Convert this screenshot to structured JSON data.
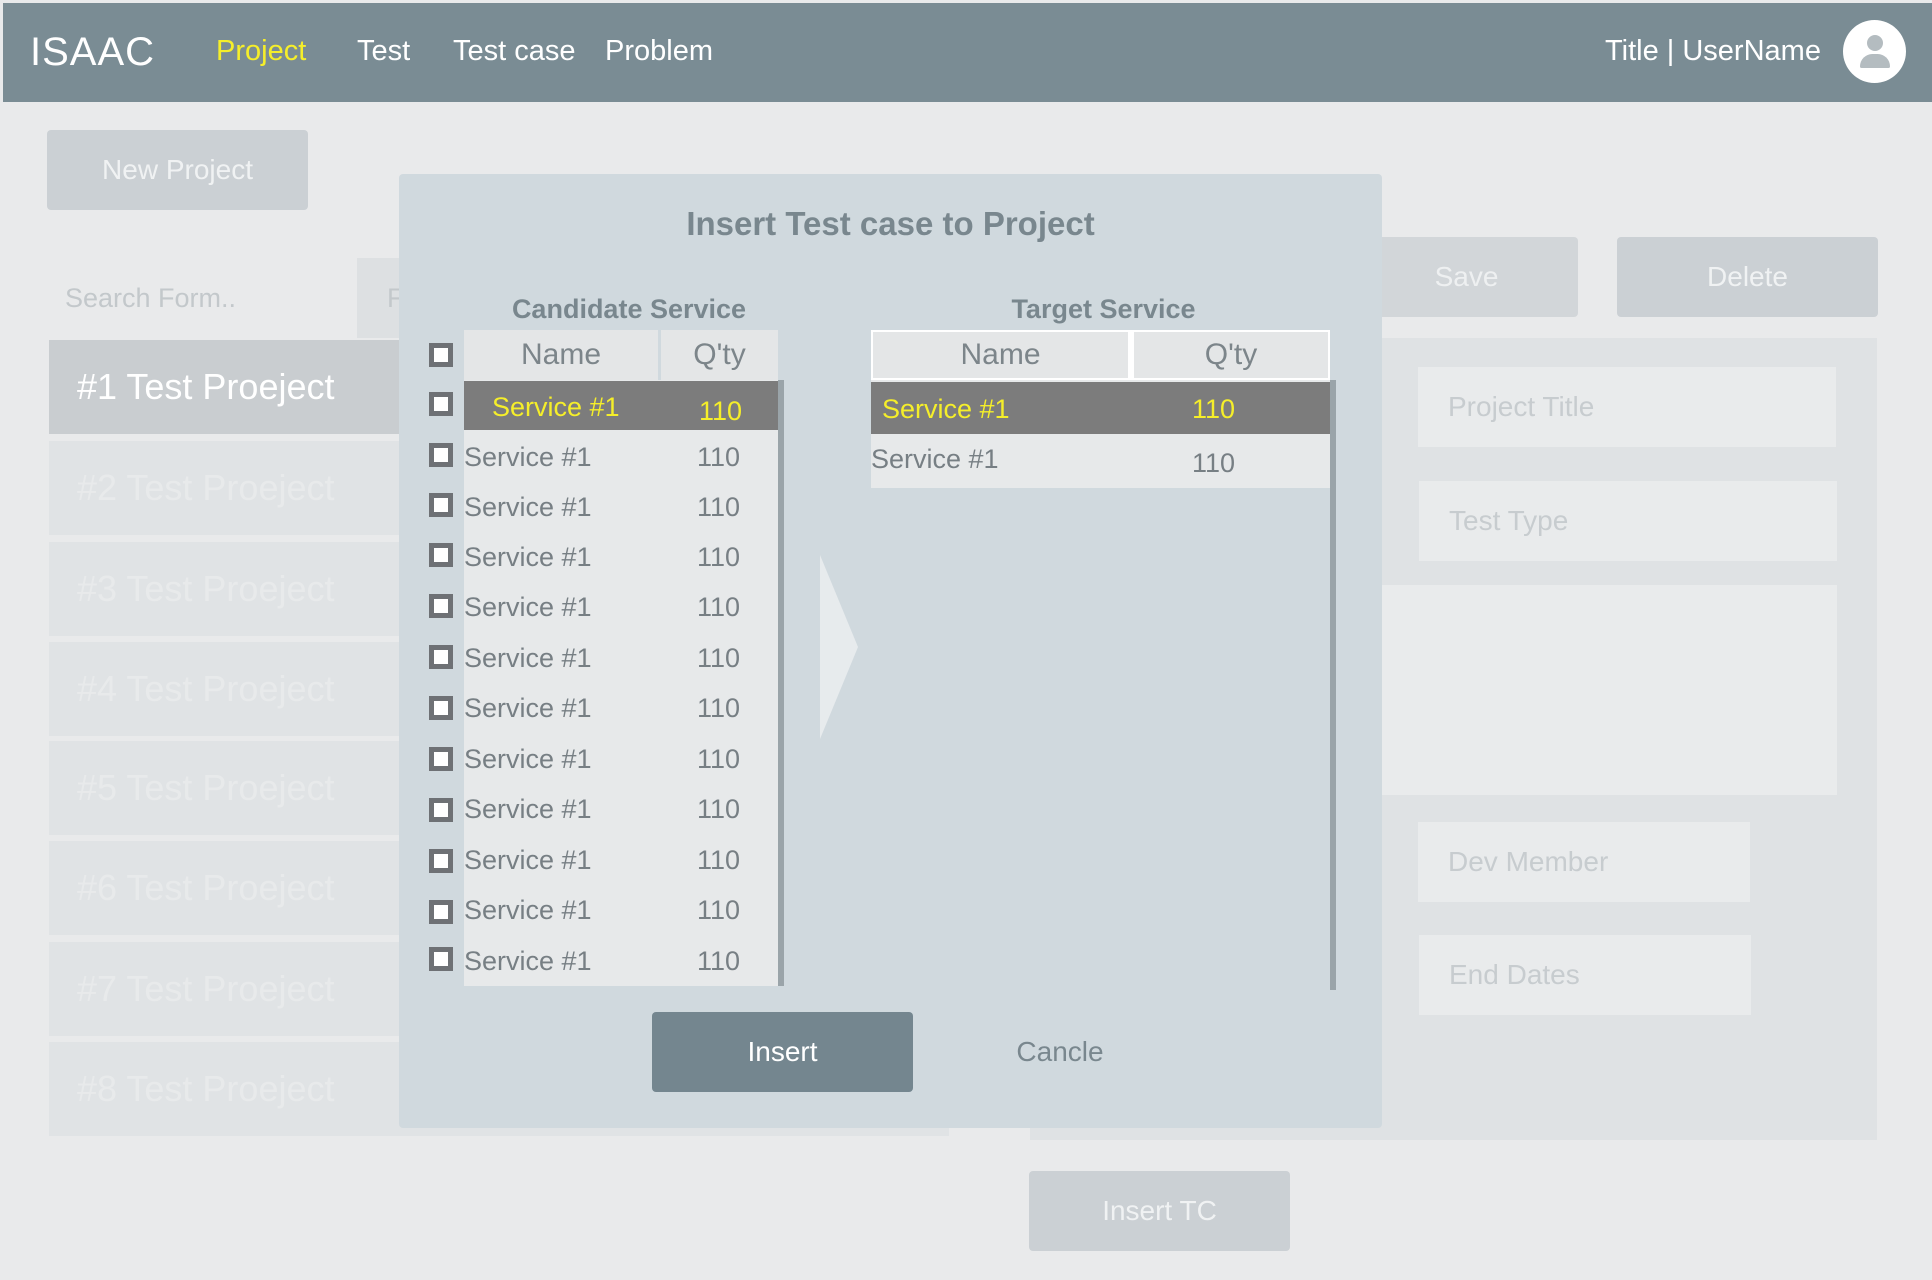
{
  "header": {
    "logo": "ISAAC",
    "nav": [
      "Project",
      "Test",
      "Test case",
      "Problem"
    ],
    "active_nav": "Project",
    "user_title": "Title | UserName",
    "avatar_icon": "user-avatar-icon"
  },
  "background": {
    "new_project_label": "New Project",
    "search_placeholder": "Search Form..",
    "filter_label": "F",
    "projects": [
      "#1 Test Proeject",
      "#2 Test Proeject",
      "#3 Test Proeject",
      "#4 Test Proeject",
      "#5 Test Proeject",
      "#6 Test Proeject",
      "#7 Test Proeject",
      "#8 Test Proeject"
    ],
    "save_label": "Save",
    "delete_label": "Delete",
    "fields": {
      "project_title": "Project Title",
      "test_type": "Test Type",
      "dev_member": "Dev Member",
      "end_dates": "End Dates"
    },
    "insert_tc_label": "Insert TC"
  },
  "modal": {
    "title": "Insert Test case to Project",
    "candidate": {
      "title": "Candidate Service",
      "columns": [
        "Name",
        "Q'ty"
      ],
      "rows": [
        {
          "name": "Service #1",
          "qty": "110",
          "selected": true
        },
        {
          "name": "Service #1",
          "qty": "110"
        },
        {
          "name": "Service #1",
          "qty": "110"
        },
        {
          "name": "Service #1",
          "qty": "110"
        },
        {
          "name": "Service #1",
          "qty": "110"
        },
        {
          "name": "Service #1",
          "qty": "110"
        },
        {
          "name": "Service #1",
          "qty": "110"
        },
        {
          "name": "Service #1",
          "qty": "110"
        },
        {
          "name": "Service #1",
          "qty": "110"
        },
        {
          "name": "Service #1",
          "qty": "110"
        },
        {
          "name": "Service #1",
          "qty": "110"
        },
        {
          "name": "Service #1",
          "qty": "110"
        }
      ]
    },
    "target": {
      "title": "Target Service",
      "columns": [
        "Name",
        "Q'ty"
      ],
      "rows": [
        {
          "name": "Service #1",
          "qty": "110",
          "selected": true
        },
        {
          "name": "Service #1",
          "qty": "110"
        }
      ]
    },
    "insert_label": "Insert",
    "cancel_label": "Cancle"
  },
  "colors": {
    "header_bg": "#7a8c94",
    "active_nav": "#f5ee2a",
    "selected_row_bg": "#7c7c7c",
    "selected_row_text": "#f5ee2a",
    "primary_button": "#74868f"
  }
}
